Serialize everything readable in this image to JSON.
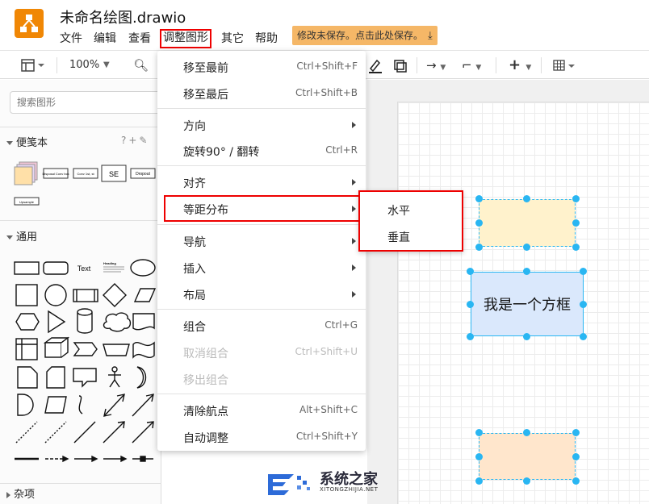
{
  "app": {
    "title": "未命名绘图.drawio",
    "brand_color": "#f08705"
  },
  "menubar": {
    "items": [
      "文件",
      "编辑",
      "查看",
      "调整图形",
      "其它",
      "帮助"
    ],
    "save_notice": "修改未保存。点击此处保存。"
  },
  "toolbar": {
    "zoom": "100%"
  },
  "sidebar": {
    "search_placeholder": "搜索图形",
    "scratchpad": "便笺本",
    "scratchpad_tools": "?+✎",
    "general": "通用",
    "misc": "杂项",
    "scratch_items": [
      "Disposal Conv bck",
      "Conv 1st, st",
      "SE",
      "Dropout",
      "Upsample"
    ],
    "text_shape": "Text",
    "heading_shape": "Heading"
  },
  "dropdown": {
    "items": [
      {
        "label": "移至最前",
        "shortcut": "Ctrl+Shift+F"
      },
      {
        "label": "移至最后",
        "shortcut": "Ctrl+Shift+B"
      },
      {
        "label": "方向",
        "shortcut": ""
      },
      {
        "label": "旋转90° / 翻转",
        "shortcut": "Ctrl+R"
      },
      {
        "label": "对齐",
        "shortcut": ""
      },
      {
        "label": "等距分布",
        "shortcut": ""
      },
      {
        "label": "导航",
        "shortcut": ""
      },
      {
        "label": "插入",
        "shortcut": ""
      },
      {
        "label": "布局",
        "shortcut": ""
      },
      {
        "label": "组合",
        "shortcut": "Ctrl+G"
      },
      {
        "label": "取消组合",
        "shortcut": "Ctrl+Shift+U"
      },
      {
        "label": "移出组合",
        "shortcut": ""
      },
      {
        "label": "清除航点",
        "shortcut": "Alt+Shift+C"
      },
      {
        "label": "自动调整",
        "shortcut": "Ctrl+Shift+Y"
      }
    ]
  },
  "submenu": {
    "items": [
      "水平",
      "垂直"
    ]
  },
  "canvas": {
    "box_label": "我是一个方框",
    "colors": {
      "yellow": "#fff2cc",
      "blue": "#dae8fc",
      "orange": "#ffe6cc",
      "handle": "#29b6f2"
    }
  },
  "watermark": {
    "text": "系统之家",
    "sub": "XITONGZHIJIA.NET"
  }
}
